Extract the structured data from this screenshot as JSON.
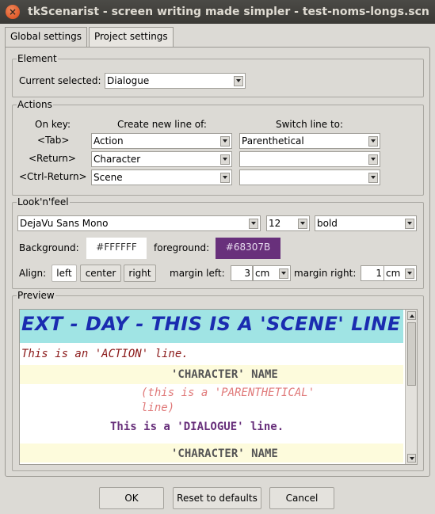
{
  "window": {
    "title": "tkScenarist - screen writing made simpler - test-noms-longs.scn"
  },
  "tabs": [
    {
      "label": "Global settings",
      "active": true
    },
    {
      "label": "Project settings",
      "active": false
    }
  ],
  "element": {
    "legend": "Element",
    "current_label": "Current selected:",
    "current_value": "Dialogue"
  },
  "actions": {
    "legend": "Actions",
    "headers": {
      "on_key": "On key:",
      "create": "Create new line of:",
      "switch": "Switch line to:"
    },
    "rows": [
      {
        "key": "<Tab>",
        "create": "Action",
        "switch": "Parenthetical"
      },
      {
        "key": "<Return>",
        "create": "Character",
        "switch": ""
      },
      {
        "key": "<Ctrl-Return>",
        "create": "Scene",
        "switch": ""
      }
    ]
  },
  "looknfeel": {
    "legend": "Look'n'feel",
    "font_family": "DejaVu Sans Mono",
    "font_size": "12",
    "font_style": "bold",
    "background_label": "Background:",
    "background_value": "#FFFFFF",
    "foreground_label": "foreground:",
    "foreground_value": "#68307B",
    "align_label": "Align:",
    "align_left": "left",
    "align_center": "center",
    "align_right": "right",
    "align_selected": "left",
    "margin_left_label": "margin left:",
    "margin_left_value": "3",
    "margin_left_unit": "cm",
    "margin_right_label": "margin right:",
    "margin_right_value": "1",
    "margin_right_unit": "cm"
  },
  "preview": {
    "legend": "Preview",
    "scene": "EXT - DAY - THIS IS A 'SCENE' LINE",
    "action": "This is an 'ACTION' line.",
    "character": "'CHARACTER' NAME",
    "parenthetical_1": "(this is a 'PARENTHETICAL'",
    "parenthetical_2": "line)",
    "dialogue": "This is a 'DIALOGUE' line.",
    "character_2": "'CHARACTER' NAME",
    "colors": {
      "scene_bg": "#a0e4e4",
      "scene_fg": "#1a2cb0",
      "action_fg": "#8b1a1a",
      "character_bg": "#fdfbdc",
      "character_fg": "#555555",
      "parenthetical_fg": "#e07a7a",
      "dialogue_fg": "#68307B"
    }
  },
  "buttons": {
    "ok": "OK",
    "reset": "Reset to defaults",
    "cancel": "Cancel"
  }
}
